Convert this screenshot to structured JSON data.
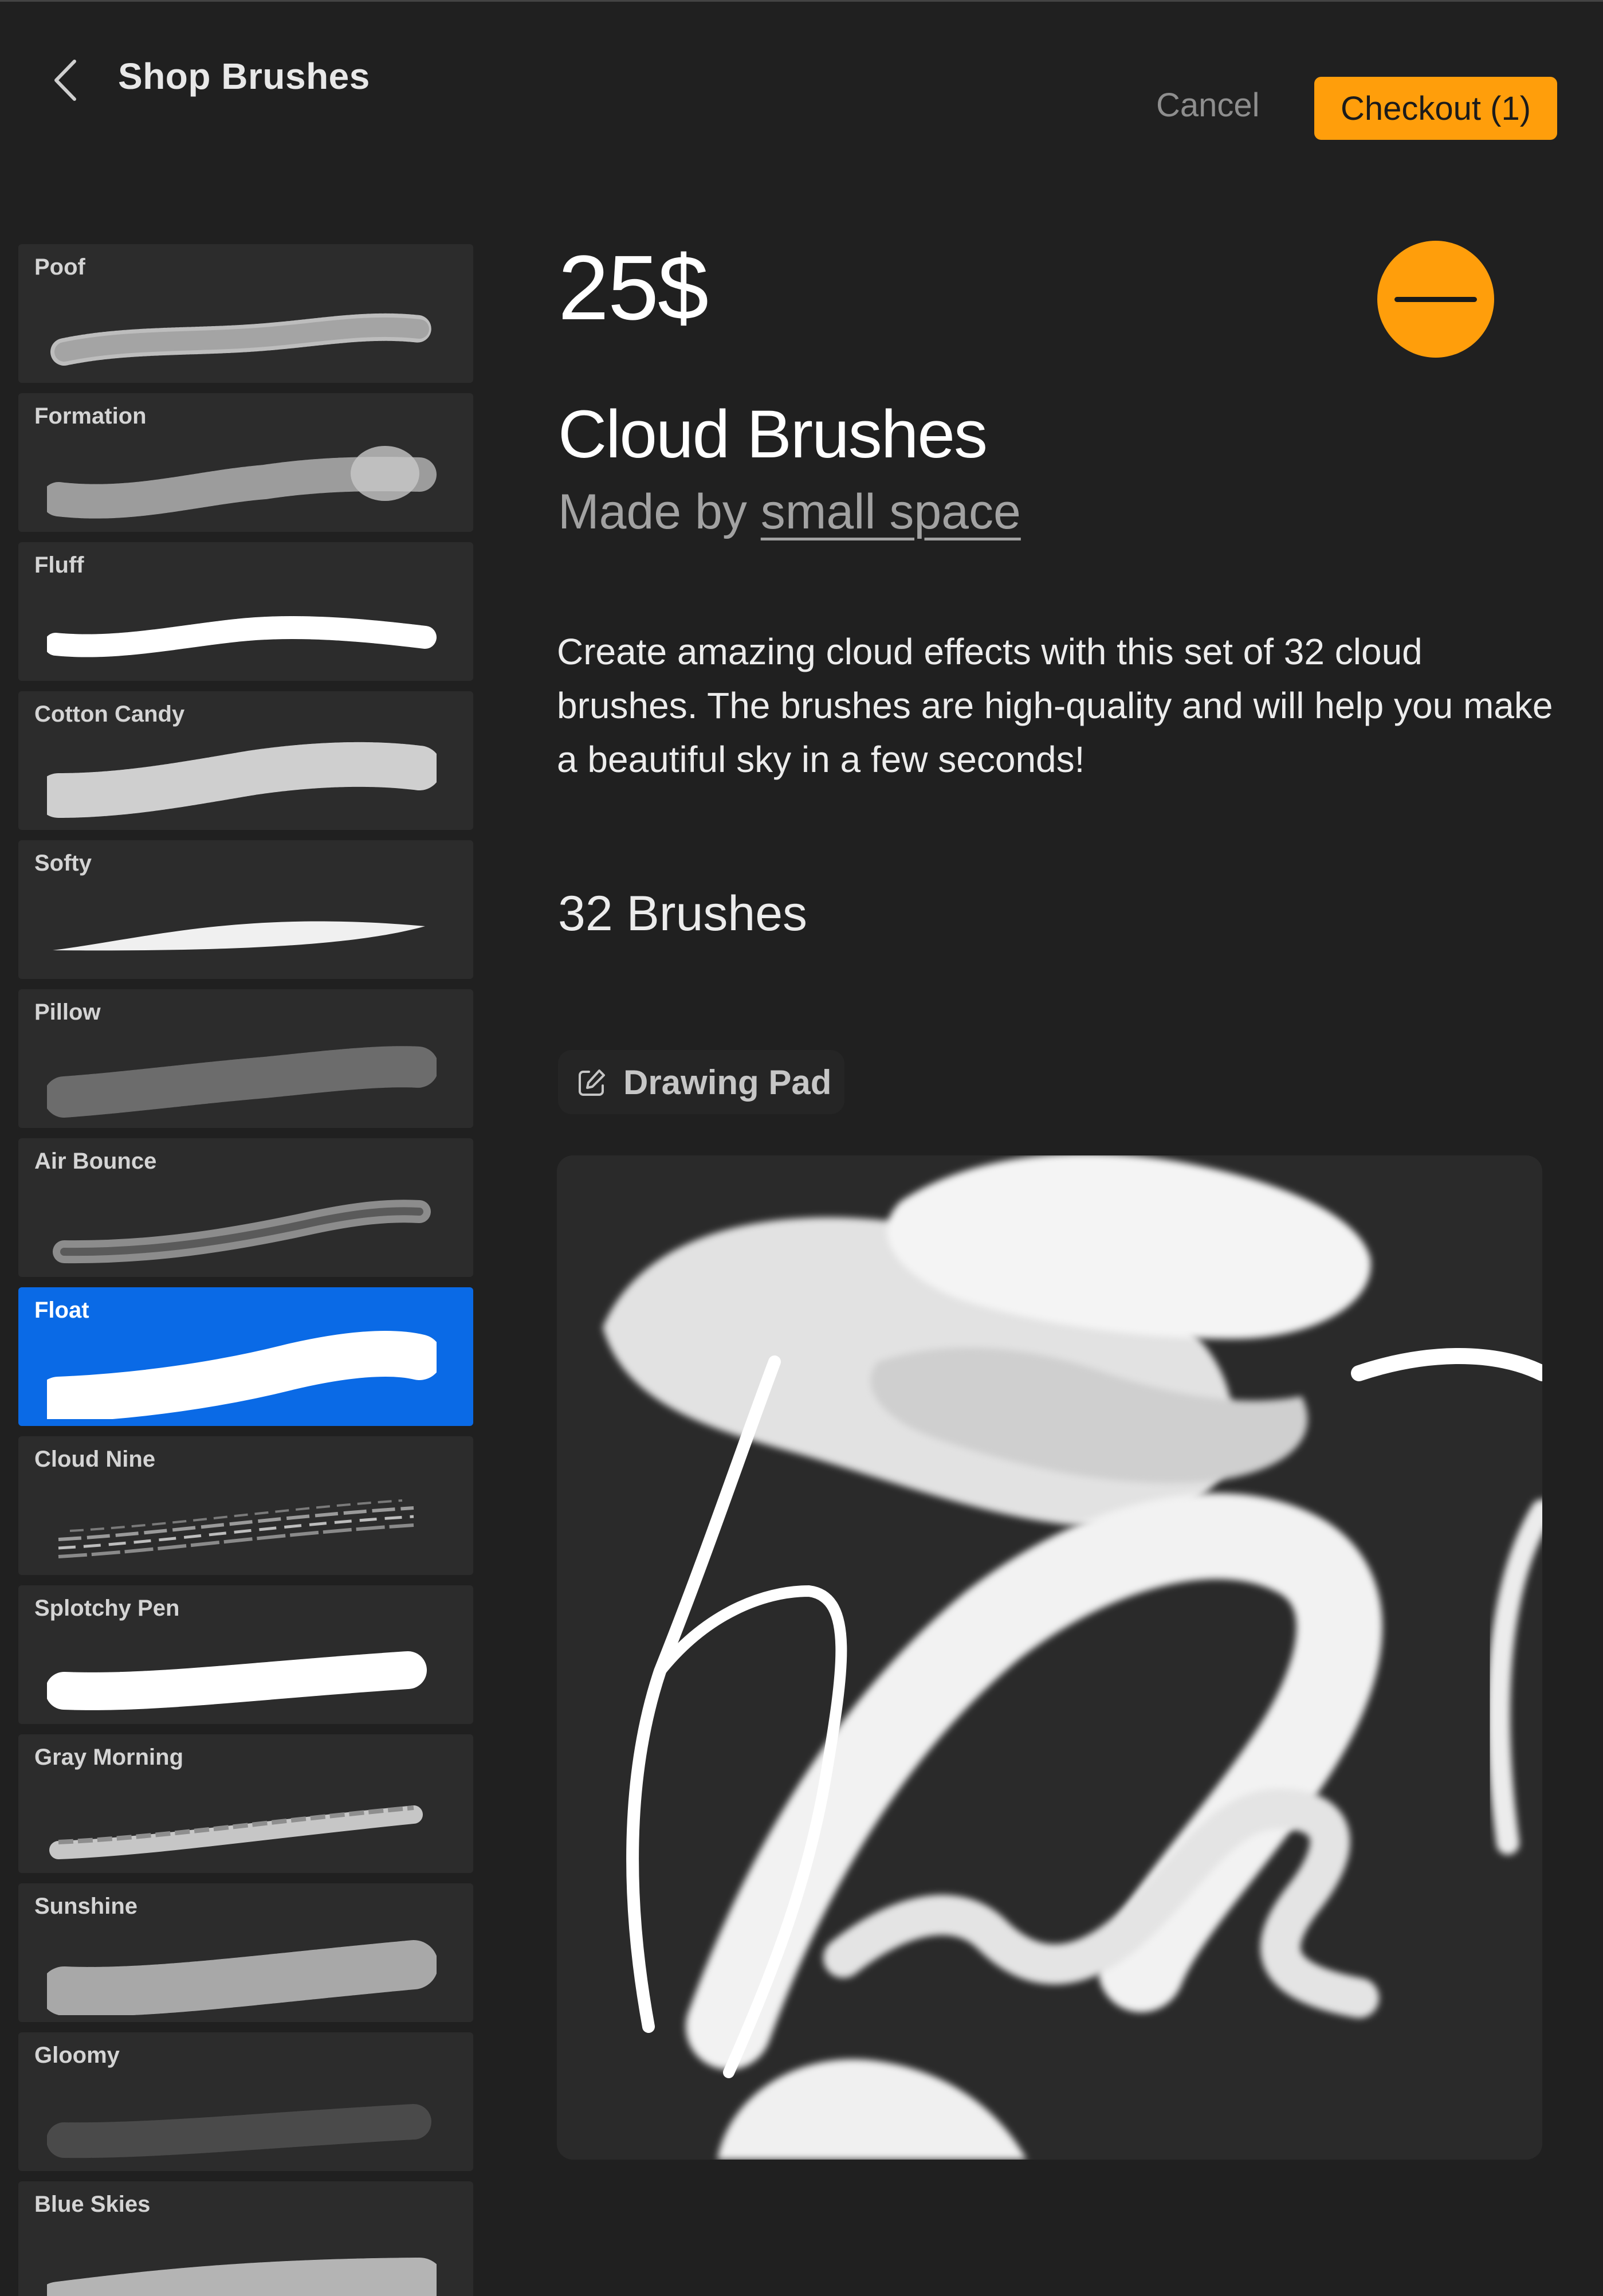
{
  "header": {
    "title": "Shop Brushes",
    "cancel_label": "Cancel",
    "checkout_label": "Checkout (1)"
  },
  "sidebar": {
    "selected": "Float",
    "items": [
      {
        "label": "Poof"
      },
      {
        "label": "Formation"
      },
      {
        "label": "Fluff"
      },
      {
        "label": "Cotton Candy"
      },
      {
        "label": "Softy"
      },
      {
        "label": "Pillow"
      },
      {
        "label": "Air Bounce"
      },
      {
        "label": "Float"
      },
      {
        "label": "Cloud Nine"
      },
      {
        "label": "Splotchy Pen"
      },
      {
        "label": "Gray Morning"
      },
      {
        "label": "Sunshine"
      },
      {
        "label": "Gloomy"
      },
      {
        "label": "Blue Skies"
      }
    ]
  },
  "product": {
    "price": "25$",
    "title": "Cloud Brushes",
    "made_by_prefix": "Made by ",
    "author": "small space",
    "description": "Create amazing cloud effects with this set of 32 cloud brushes. The brushes are high-quality and will help you make a beautiful sky in a few seconds!",
    "brush_count": "32 Brushes",
    "drawing_pad_label": "Drawing Pad"
  },
  "icons": {
    "back": "chevron-left-icon",
    "remove": "minus-icon",
    "drawing_pad": "edit-icon"
  },
  "colors": {
    "background": "#202020",
    "accent": "#ff9e0b",
    "selected": "#0a6ae6",
    "item_background": "#2c2c2c"
  }
}
